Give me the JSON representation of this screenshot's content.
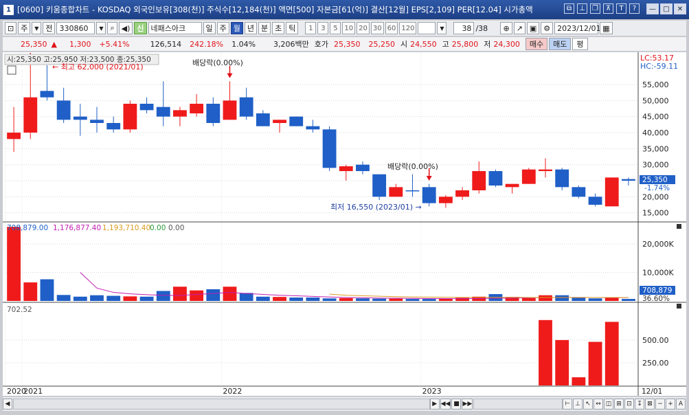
{
  "window": {
    "badge": "1",
    "title": "[0600] 키움종합차트 - KOSDAQ 외국인보유[308(천)] 주식수[12,184(천)] 액면[500] 자본금[61(억)] 결산[12월] EPS[2,109] PER[12.04] 시가총액",
    "icons": [
      "window-link-icon",
      "pin-icon",
      "restore-icon",
      "pin-2-icon",
      "text-icon",
      "help-icon"
    ],
    "minimize": "—",
    "maximize": "□",
    "close": "✕"
  },
  "toolbar": {
    "type_selector": "주",
    "scope_selector": "전",
    "code": "330860",
    "market_badge": "신",
    "stock_name": "네패스아크",
    "periods": [
      "일",
      "주",
      "월",
      "년",
      "분",
      "초",
      "틱"
    ],
    "active_period": "월",
    "intervals": [
      "1",
      "3",
      "5",
      "10",
      "20",
      "30",
      "60",
      "120"
    ],
    "count": "38",
    "count_total": "/38",
    "date": "2023/12/01"
  },
  "quote": {
    "price": "25,350",
    "arrow": "▲",
    "change": "1,300",
    "rate": "+5.41%",
    "volume": "126,514",
    "vol_ratio": "242.18%",
    "turnover": "1.04%",
    "amount": "3,206백만",
    "bid_label": "호가",
    "bid1": "25,350",
    "bid2": "25,250",
    "open_label": "시",
    "open": "24,550",
    "high_label": "고",
    "high": "25,800",
    "low_label": "저",
    "low": "24,300",
    "buy": "매수",
    "sell": "매도",
    "flat": "평"
  },
  "chart_panel": {
    "overlay_text": "시:25,350 고:25,950 저:23,500 종:25,350",
    "label_high": "← 최고 62,000 (2021/01)",
    "label_low": "최저 16,550 (2023/01) →",
    "dividend1": "배당락(0.00%)",
    "dividend2": "배당락(0.00%)",
    "lc": "LC:53.17",
    "hc": "HC:-59.11",
    "price_tag": "25,350",
    "price_rate_tag": "-1.74%",
    "volume_legend": [
      "708,879.00",
      "1,176,877.40",
      "1,193,710.40",
      "0.00",
      "0.00"
    ],
    "volume_tag": "708,879",
    "volume_pct_tag": "36.60%",
    "third_legend": "702.52",
    "end_date": "12/01"
  },
  "chart_data": [
    {
      "type": "candlestick",
      "title": "",
      "x_labels": [
        "2020",
        "2021",
        "2022",
        "2023"
      ],
      "ylim": [
        13000,
        64000
      ],
      "y_ticks": [
        15000,
        20000,
        25000,
        30000,
        35000,
        40000,
        45000,
        50000,
        55000
      ],
      "y_tick_labels": [
        "15,000",
        "20,000",
        "25,000",
        "30,000",
        "35,000",
        "40,000",
        "45,000",
        "50,000",
        "55,000"
      ],
      "candles": [
        {
          "o": 38000,
          "h": 48000,
          "l": 34000,
          "c": 40000,
          "up": true
        },
        {
          "o": 40000,
          "h": 62000,
          "l": 38000,
          "c": 51000,
          "up": true
        },
        {
          "o": 51000,
          "h": 61000,
          "l": 50000,
          "c": 53000,
          "up": false
        },
        {
          "o": 50000,
          "h": 54000,
          "l": 43000,
          "c": 44000,
          "up": false
        },
        {
          "o": 45000,
          "h": 49000,
          "l": 39000,
          "c": 44000,
          "up": false
        },
        {
          "o": 44000,
          "h": 48000,
          "l": 40000,
          "c": 43000,
          "up": false
        },
        {
          "o": 43000,
          "h": 45000,
          "l": 40000,
          "c": 41000,
          "up": false
        },
        {
          "o": 41000,
          "h": 50000,
          "l": 40000,
          "c": 49000,
          "up": true
        },
        {
          "o": 49000,
          "h": 51000,
          "l": 46000,
          "c": 47000,
          "up": false
        },
        {
          "o": 48000,
          "h": 56000,
          "l": 42000,
          "c": 45000,
          "up": false
        },
        {
          "o": 45000,
          "h": 48000,
          "l": 42000,
          "c": 47000,
          "up": true
        },
        {
          "o": 46000,
          "h": 52000,
          "l": 45000,
          "c": 49000,
          "up": true
        },
        {
          "o": 49000,
          "h": 51000,
          "l": 42000,
          "c": 43000,
          "up": false
        },
        {
          "o": 44000,
          "h": 56000,
          "l": 44000,
          "c": 50000,
          "up": true
        },
        {
          "o": 51000,
          "h": 54000,
          "l": 44000,
          "c": 45000,
          "up": false
        },
        {
          "o": 46000,
          "h": 47000,
          "l": 42000,
          "c": 42000,
          "up": false
        },
        {
          "o": 43000,
          "h": 44000,
          "l": 40000,
          "c": 44000,
          "up": true
        },
        {
          "o": 45000,
          "h": 45000,
          "l": 42000,
          "c": 42000,
          "up": false
        },
        {
          "o": 42000,
          "h": 44000,
          "l": 40000,
          "c": 41000,
          "up": false
        },
        {
          "o": 41000,
          "h": 42000,
          "l": 28000,
          "c": 29000,
          "up": false
        },
        {
          "o": 28000,
          "h": 30000,
          "l": 25000,
          "c": 29500,
          "up": true
        },
        {
          "o": 30000,
          "h": 31000,
          "l": 27000,
          "c": 28000,
          "up": false
        },
        {
          "o": 27000,
          "h": 27000,
          "l": 19000,
          "c": 20000,
          "up": false
        },
        {
          "o": 20000,
          "h": 24000,
          "l": 20000,
          "c": 23000,
          "up": true
        },
        {
          "o": 22000,
          "h": 27000,
          "l": 20000,
          "c": 21800,
          "up": false
        },
        {
          "o": 23000,
          "h": 24000,
          "l": 17000,
          "c": 18000,
          "up": false
        },
        {
          "o": 18000,
          "h": 20500,
          "l": 16550,
          "c": 20000,
          "up": true
        },
        {
          "o": 20000,
          "h": 23000,
          "l": 19000,
          "c": 22000,
          "up": true
        },
        {
          "o": 22000,
          "h": 31000,
          "l": 21000,
          "c": 28000,
          "up": true
        },
        {
          "o": 28000,
          "h": 28500,
          "l": 23000,
          "c": 23500,
          "up": false
        },
        {
          "o": 23000,
          "h": 24000,
          "l": 21000,
          "c": 24000,
          "up": true
        },
        {
          "o": 24000,
          "h": 29000,
          "l": 24000,
          "c": 28500,
          "up": true
        },
        {
          "o": 28500,
          "h": 32000,
          "l": 26000,
          "c": 28000,
          "up": true
        },
        {
          "o": 28500,
          "h": 29000,
          "l": 22000,
          "c": 23000,
          "up": false
        },
        {
          "o": 23000,
          "h": 23500,
          "l": 19500,
          "c": 20000,
          "up": false
        },
        {
          "o": 20000,
          "h": 21000,
          "l": 17000,
          "c": 17500,
          "up": false
        },
        {
          "o": 17000,
          "h": 26000,
          "l": 17000,
          "c": 26000,
          "up": true
        },
        {
          "o": 25500,
          "h": 26000,
          "l": 23500,
          "c": 25000,
          "up": false
        }
      ]
    },
    {
      "type": "bar",
      "title": "",
      "ylim": [
        0,
        27000
      ],
      "y_ticks": [
        10000,
        20000
      ],
      "y_tick_labels": [
        "10,000K",
        "20,000K"
      ],
      "values": [
        26000,
        6500,
        7600,
        2100,
        1500,
        2000,
        1800,
        1600,
        1500,
        3500,
        5000,
        3700,
        4100,
        5000,
        2800,
        1500,
        1400,
        1200,
        1200,
        900,
        1000,
        900,
        800,
        800,
        700,
        700,
        800,
        1100,
        1500,
        2400,
        1400,
        1000,
        2000,
        2000,
        1200,
        900,
        1100,
        709
      ],
      "ma_a": [
        null,
        null,
        null,
        null,
        10000,
        4500,
        3000,
        2500,
        2200,
        2000,
        1900,
        2300,
        2600,
        3000,
        2600,
        2300,
        2000,
        1800,
        1600,
        1400,
        1200,
        1100,
        1000,
        950,
        900,
        850,
        800,
        800,
        850,
        950,
        1000,
        1100,
        1200,
        1250,
        1250,
        1200,
        1150,
        1177
      ],
      "ma_b": [
        null,
        null,
        null,
        null,
        null,
        null,
        null,
        null,
        null,
        null,
        null,
        null,
        null,
        null,
        null,
        null,
        null,
        null,
        null,
        2400,
        2000,
        1800,
        1650,
        1500,
        1400,
        1350,
        1300,
        1250,
        1250,
        1250,
        1250,
        1250,
        1200,
        1200,
        1200,
        1200,
        1200,
        1194
      ]
    },
    {
      "type": "bar",
      "title": "",
      "ylim": [
        0,
        900
      ],
      "y_ticks": [
        250,
        500
      ],
      "y_tick_labels": [
        "250.00",
        "500.00"
      ],
      "values": [
        null,
        null,
        null,
        null,
        null,
        null,
        null,
        null,
        null,
        null,
        null,
        null,
        null,
        null,
        null,
        null,
        null,
        null,
        null,
        null,
        null,
        null,
        null,
        null,
        null,
        null,
        null,
        null,
        null,
        null,
        null,
        null,
        720,
        500,
        90,
        480,
        700,
        null
      ]
    }
  ],
  "scrollbar": {
    "buttons_left": [
      "◀"
    ],
    "nav": [
      "▶",
      "◀◀",
      "■",
      "▶▶"
    ],
    "tools": [
      "⊢",
      "⊥",
      "↖",
      "↔",
      "◫",
      "⊞",
      "⊡",
      "↧",
      "⊠"
    ],
    "zoom_minus": "−",
    "zoom_plus": "+",
    "font_btn": "A"
  },
  "colors": {
    "up": "#ef1b1b",
    "down": "#1f5fc7",
    "ma_a": "#c01cb0",
    "ma_b": "#d99a20"
  }
}
